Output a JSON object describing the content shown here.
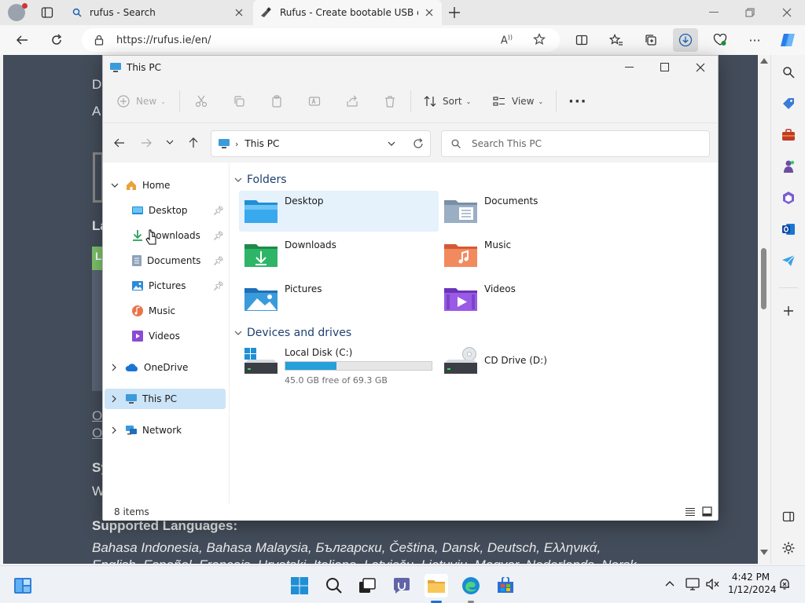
{
  "browser": {
    "tabs": [
      {
        "title": "rufus - Search",
        "icon": "search-icon"
      },
      {
        "title": "Rufus - Create bootable USB driv",
        "icon": "rufus-icon"
      }
    ],
    "url": "https://rufus.ie/en/"
  },
  "webpage": {
    "fragments": [
      "De",
      "A",
      "La",
      "L",
      "O",
      "O",
      "Sy",
      "W"
    ],
    "supported_languages_label": "Supported Languages:",
    "languages_line": "Bahasa Indonesia, Bahasa Malaysia, Български, Čeština, Dansk, Deutsch, Ελληνικά,",
    "languages_line2": "English, Español, Français, Hrvatski, Italiano, Latviešu, Lietuvių, Magyar, Nederlands, Norsk,"
  },
  "explorer": {
    "title": "This PC",
    "toolbar": {
      "new": "New",
      "sort": "Sort",
      "view": "View"
    },
    "address": "This PC",
    "search_placeholder": "Search This PC",
    "nav": [
      {
        "label": "Home",
        "icon": "home-icon",
        "expanded": true
      },
      {
        "label": "Desktop",
        "icon": "desktop-folder-icon",
        "pinned": true
      },
      {
        "label": "Downloads",
        "icon": "downloads-folder-icon",
        "pinned": true
      },
      {
        "label": "Documents",
        "icon": "documents-folder-icon",
        "pinned": true
      },
      {
        "label": "Pictures",
        "icon": "pictures-folder-icon",
        "pinned": true
      },
      {
        "label": "Music",
        "icon": "music-folder-icon"
      },
      {
        "label": "Videos",
        "icon": "videos-folder-icon"
      },
      {
        "label": "OneDrive",
        "icon": "onedrive-icon"
      },
      {
        "label": "This PC",
        "icon": "this-pc-icon",
        "selected": true
      },
      {
        "label": "Network",
        "icon": "network-icon"
      }
    ],
    "groups": {
      "folders": "Folders",
      "devices": "Devices and drives"
    },
    "folders": [
      {
        "label": "Desktop",
        "color": "#1f8fd6"
      },
      {
        "label": "Documents",
        "color": "#7a8fa6"
      },
      {
        "label": "Downloads",
        "color": "#27a35a"
      },
      {
        "label": "Music",
        "color": "#e8744a"
      },
      {
        "label": "Pictures",
        "color": "#2d8ad6"
      },
      {
        "label": "Videos",
        "color": "#8a4ad6"
      }
    ],
    "drives": [
      {
        "label": "Local Disk (C:)",
        "free": "45.0 GB free of 69.3 GB",
        "used_fraction": 0.35
      },
      {
        "label": "CD Drive (D:)"
      }
    ],
    "status": "8 items"
  },
  "taskbar": {
    "time": "4:42 PM",
    "date": "1/12/2024"
  }
}
